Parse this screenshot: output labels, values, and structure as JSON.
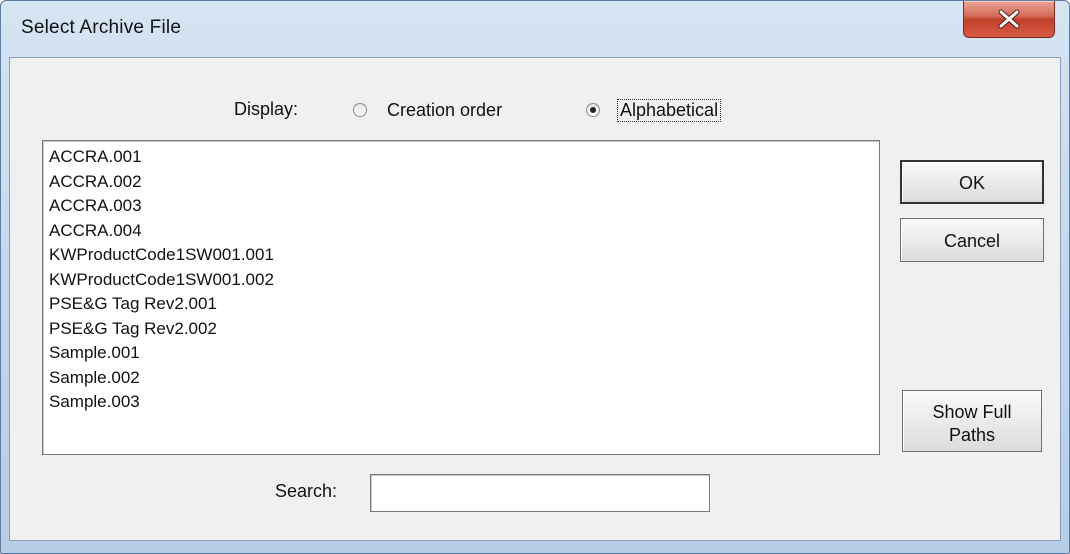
{
  "window": {
    "title": "Select Archive File"
  },
  "display": {
    "label": "Display:",
    "options": [
      {
        "label": "Creation order",
        "selected": false
      },
      {
        "label": "Alphabetical",
        "selected": true
      }
    ]
  },
  "file_list": {
    "items": [
      "ACCRA.001",
      "ACCRA.002",
      "ACCRA.003",
      "ACCRA.004",
      "KWProductCode1SW001.001",
      "KWProductCode1SW001.002",
      "PSE&G Tag Rev2.001",
      "PSE&G Tag Rev2.002",
      "Sample.001",
      "Sample.002",
      "Sample.003"
    ]
  },
  "buttons": {
    "ok": "OK",
    "cancel": "Cancel",
    "show_full_paths_line1": "Show Full",
    "show_full_paths_line2": "Paths"
  },
  "search": {
    "label": "Search:",
    "value": ""
  },
  "colors": {
    "title_gradient_top": "#d6e4f3",
    "client_bg": "#f0f0f0",
    "close_button": "#c0402c"
  }
}
